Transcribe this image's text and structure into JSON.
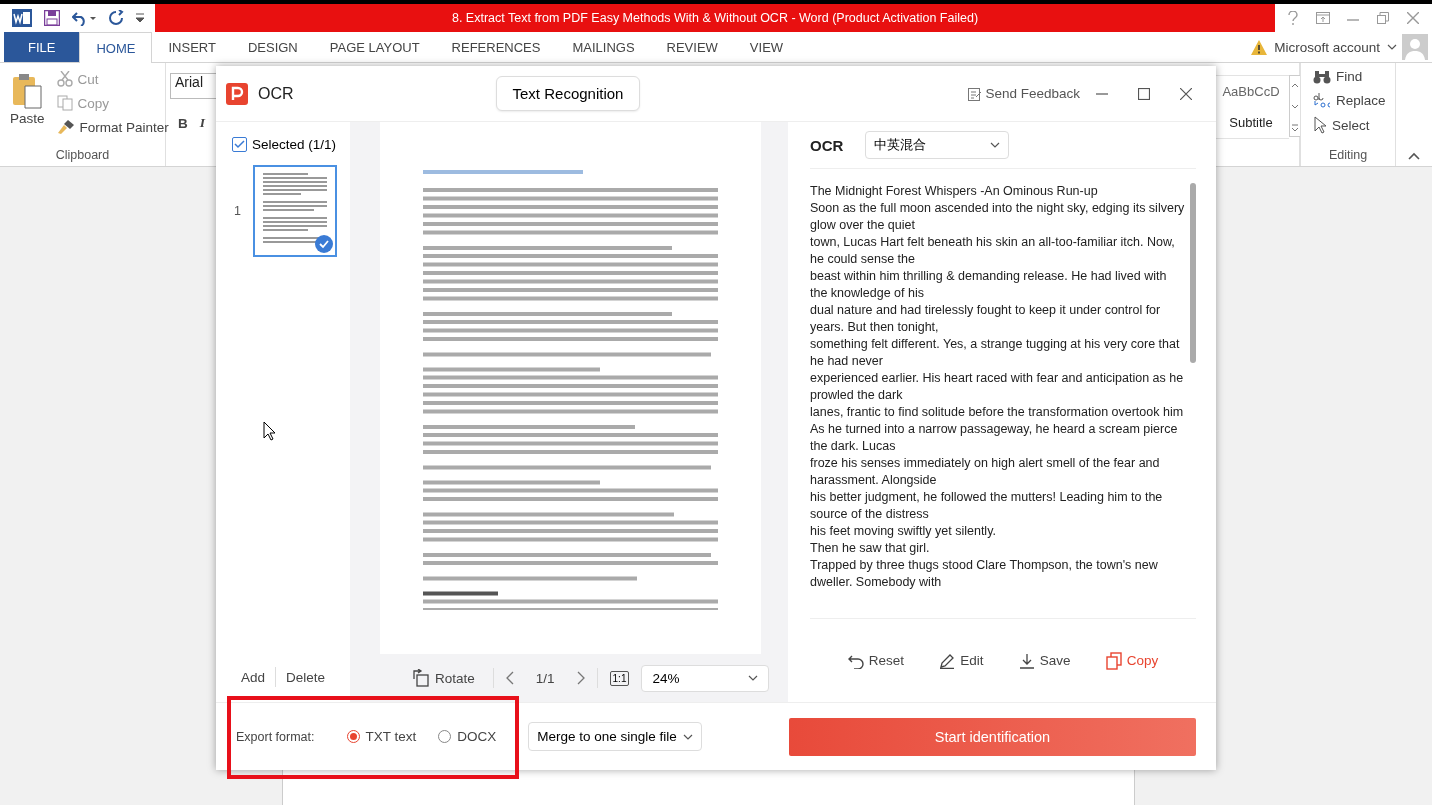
{
  "word": {
    "title": "8. Extract Text from PDF Easy Methods With & Without OCR -  Word (Product Activation Failed)",
    "tabs": [
      {
        "label": "FILE",
        "kind": "file",
        "selected": false
      },
      {
        "label": "HOME",
        "kind": "tab",
        "selected": true
      },
      {
        "label": "INSERT",
        "kind": "tab",
        "selected": false
      },
      {
        "label": "DESIGN",
        "kind": "tab",
        "selected": false
      },
      {
        "label": "PAGE LAYOUT",
        "kind": "tab",
        "selected": false
      },
      {
        "label": "REFERENCES",
        "kind": "tab",
        "selected": false
      },
      {
        "label": "MAILINGS",
        "kind": "tab",
        "selected": false
      },
      {
        "label": "REVIEW",
        "kind": "tab",
        "selected": false
      },
      {
        "label": "VIEW",
        "kind": "tab",
        "selected": false
      }
    ],
    "account": "Microsoft account",
    "clipboard": {
      "paste": "Paste",
      "cut": "Cut",
      "copy": "Copy",
      "format_painter": "Format Painter",
      "group": "Clipboard"
    },
    "font": {
      "name": "Arial",
      "bold": "B",
      "italic": "I"
    },
    "styles": {
      "sample": "AaBbCcD",
      "name": "Subtitle"
    },
    "editing": {
      "find": "Find",
      "replace": "Replace",
      "select": "Select",
      "group": "Editing"
    }
  },
  "ocr": {
    "title": "OCR",
    "mode_button": "Text Recognition",
    "feedback": "Send Feedback",
    "select_all": {
      "label": "Selected (1/1)",
      "checked": true
    },
    "pages": [
      {
        "number": "1",
        "selected": true
      }
    ],
    "add": "Add",
    "delete": "Delete",
    "toolbar": {
      "rotate": "Rotate",
      "page": "1/1",
      "fit": "1:1",
      "zoom": "24%"
    },
    "result_label": "OCR",
    "language": "中英混合",
    "result_lines": [
      "The Midnight Forest Whispers -An Ominous Run-up",
      "Soon as the full moon ascended into the night sky, edging its silvery glow over the quiet",
      "town, Lucas Hart felt beneath his skin an all-too-familiar itch. Now, he could sense the",
      "beast within him thrilling & demanding release. He had lived with the knowledge of his",
      "dual nature and had tirelessly fought to keep it under control for years. But then tonight,",
      "something felt different. Yes, a strange tugging at his very core that he had never",
      "experienced earlier. His heart raced with fear and anticipation as he prowled the dark",
      "lanes, frantic to find solitude before the transformation overtook him",
      "As he turned into a narrow passageway, he heard a scream pierce the dark. Lucas",
      "froze his senses immediately on high alert smell of the fear and harassment. Alongside",
      "his better judgment, he followed the mutters! Leading him to the source of the distress",
      "his feet moving swiftly yet silently.",
      "Then he saw that girl.",
      "Trapped by three thugs stood Clare Thompson, the town's new dweller. Somebody with"
    ],
    "actions": [
      {
        "kind": "reset",
        "label": "Reset"
      },
      {
        "kind": "edit",
        "label": "Edit"
      },
      {
        "kind": "save",
        "label": "Save"
      },
      {
        "kind": "copy",
        "label": "Copy"
      }
    ],
    "export": {
      "label": "Export format:",
      "options": [
        {
          "label": "TXT text",
          "selected": true
        },
        {
          "label": "DOCX",
          "selected": false
        }
      ]
    },
    "merge": "Merge to one single file",
    "start": "Start identification"
  }
}
